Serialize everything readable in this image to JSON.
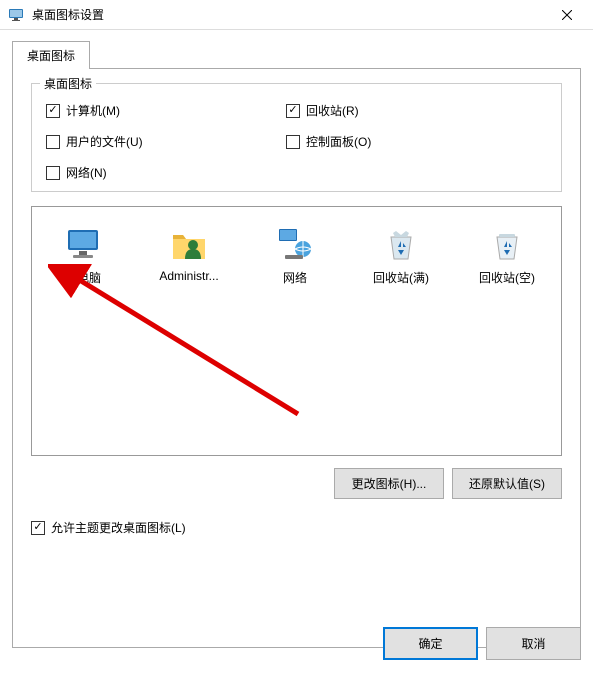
{
  "window": {
    "title": "桌面图标设置"
  },
  "tab": {
    "label": "桌面图标"
  },
  "group": {
    "title": "桌面图标"
  },
  "checks": {
    "computer": {
      "label": "计算机(M)",
      "checked": true
    },
    "recycle": {
      "label": "回收站(R)",
      "checked": true
    },
    "userfiles": {
      "label": "用户的文件(U)",
      "checked": false
    },
    "controlpanel": {
      "label": "控制面板(O)",
      "checked": false
    },
    "network": {
      "label": "网络(N)",
      "checked": false
    }
  },
  "icons": {
    "thispc": "此电脑",
    "admin": "Administr...",
    "network": "网络",
    "recycle_full": "回收站(满)",
    "recycle_empty": "回收站(空)"
  },
  "buttons": {
    "change_icon": "更改图标(H)...",
    "restore_default": "还原默认值(S)",
    "ok": "确定",
    "cancel": "取消"
  },
  "allow_theme": {
    "label": "允许主题更改桌面图标(L)",
    "checked": true
  }
}
